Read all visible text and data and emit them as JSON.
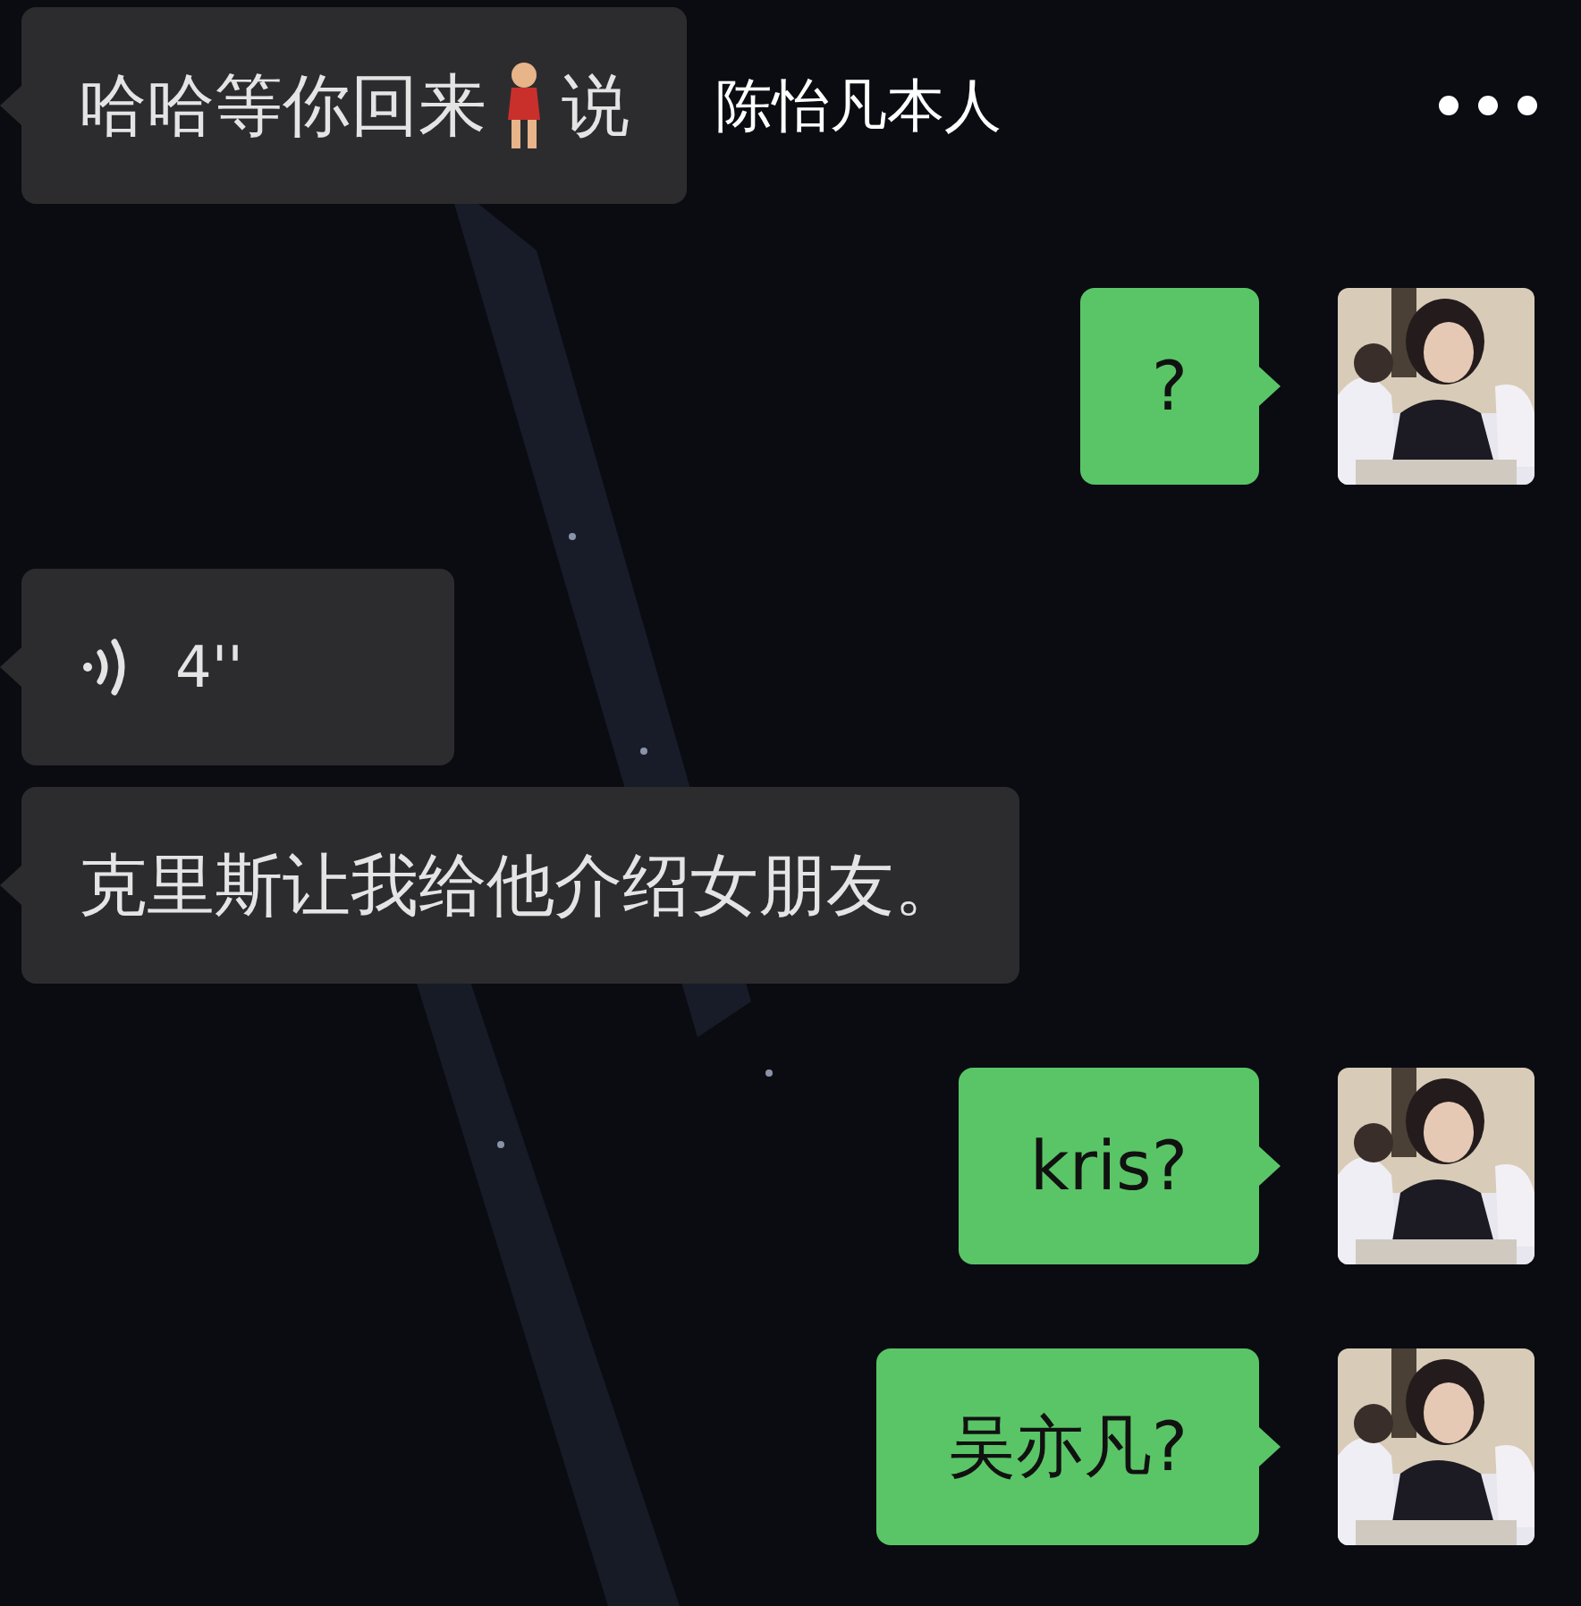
{
  "header": {
    "title": "陈怡凡本人"
  },
  "messages": [
    {
      "kind": "text_sticker",
      "outgoing": false,
      "text": "哈哈等你回来",
      "text_after": "说"
    },
    {
      "kind": "text",
      "outgoing": true,
      "text": "?"
    },
    {
      "kind": "voice",
      "outgoing": false,
      "duration": "4''"
    },
    {
      "kind": "text",
      "outgoing": false,
      "text": "克里斯让我给他介绍女朋友。"
    },
    {
      "kind": "text",
      "outgoing": true,
      "text": "kris?"
    },
    {
      "kind": "text",
      "outgoing": true,
      "text": "吴亦凡?"
    }
  ]
}
